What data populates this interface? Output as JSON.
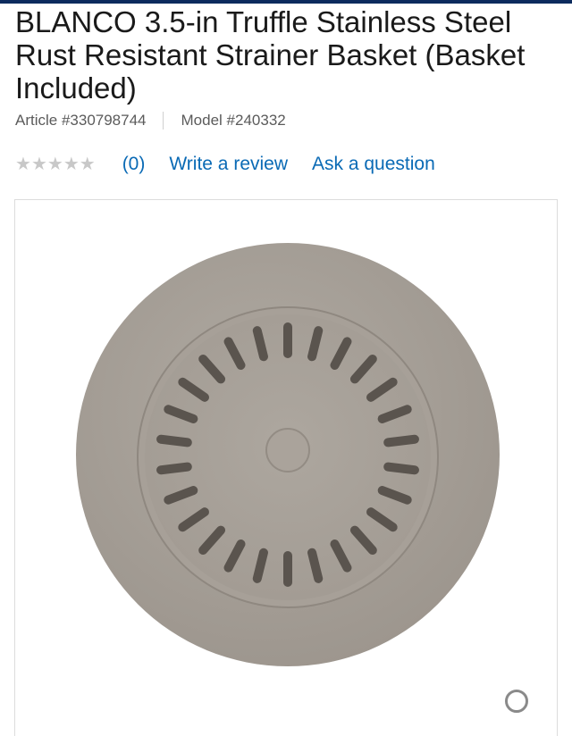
{
  "product": {
    "title": "BLANCO 3.5-in Truffle Stainless Steel Rust Resistant Strainer Basket (Basket Included)",
    "article": "Article #330798744",
    "model": "Model #240332"
  },
  "rating": {
    "stars": 0,
    "max_stars": 5,
    "count": "(0)",
    "write_review": "Write a review",
    "ask_question": "Ask a question"
  },
  "colors": {
    "header_bar": "#0d2b5e",
    "link": "#0a6ab5",
    "star_empty": "#c8c8c8",
    "product": "#a59e96"
  },
  "icons": {
    "zoom": "zoom-icon",
    "star": "star-icon"
  }
}
